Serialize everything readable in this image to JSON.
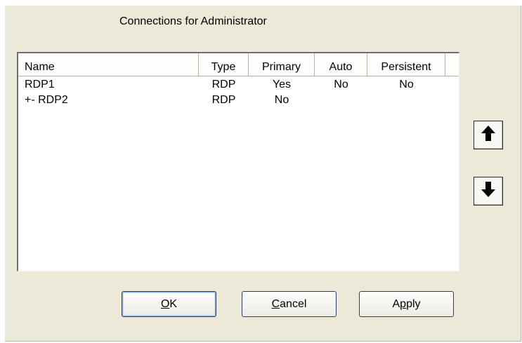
{
  "dialog": {
    "title": "Connections for Administrator"
  },
  "list": {
    "columns": [
      {
        "label": "Name"
      },
      {
        "label": "Type"
      },
      {
        "label": "Primary"
      },
      {
        "label": "Auto"
      },
      {
        "label": "Persistent"
      }
    ],
    "rows": [
      {
        "name": "RDP1",
        "type": "RDP",
        "primary": "Yes",
        "auto": "No",
        "persistent": "No"
      },
      {
        "name": "+- RDP2",
        "type": "RDP",
        "primary": "No",
        "auto": "",
        "persistent": ""
      }
    ]
  },
  "side_buttons": {
    "up_icon": "arrow-up-icon",
    "down_icon": "arrow-down-icon"
  },
  "buttons": {
    "ok": {
      "mnemonic": "O",
      "rest": "K"
    },
    "cancel": {
      "mnemonic": "C",
      "rest": "ancel"
    },
    "apply": {
      "pre": "A",
      "mnemonic": "p",
      "rest": "ply"
    }
  },
  "colors": {
    "dialog_bg": "#ece9d8",
    "default_button_focus": "#8fb3e8"
  }
}
